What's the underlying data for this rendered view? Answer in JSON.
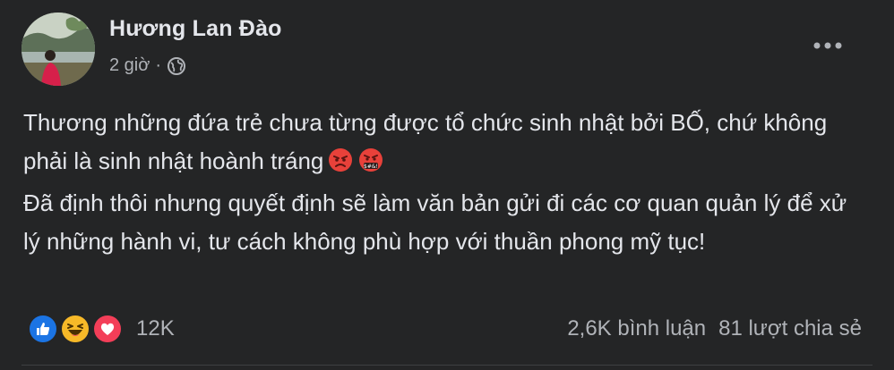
{
  "author": {
    "name": "Hương Lan Đào",
    "avatar_icon": "profile-photo"
  },
  "meta": {
    "time": "2 giờ",
    "separator": "·",
    "audience_icon": "globe-icon"
  },
  "post": {
    "paragraph_1": "Thương những đứa trẻ chưa từng được tổ chức sinh nhật bởi BỐ, chứ không phải là sinh nhật hoành tráng",
    "paragraph_1_emojis": [
      "pouting-face-emoji",
      "face-with-symbols-on-mouth-emoji"
    ],
    "paragraph_2": "Đã định thôi nhưng quyết định sẽ làm văn bản gửi đi các cơ quan quản lý để xử lý những hành vi, tư cách không phù hợp với thuần phong mỹ tục!"
  },
  "footer": {
    "reactions": [
      "like",
      "haha",
      "love"
    ],
    "reaction_count": "12K",
    "comments": "2,6K bình luận",
    "shares": "81 lượt chia sẻ"
  },
  "colors": {
    "background": "#242526",
    "text_primary": "#e4e6eb",
    "text_secondary": "#b0b3b8",
    "like_blue": "#1b74e4",
    "haha_yellow": "#f7b928",
    "love_red": "#f33e58"
  }
}
